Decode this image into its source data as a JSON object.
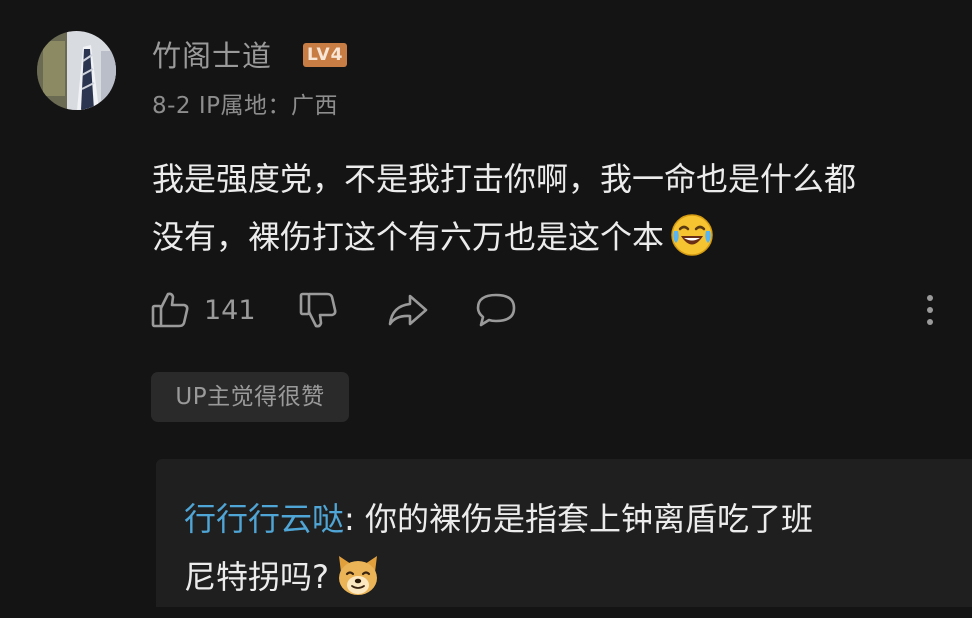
{
  "comment": {
    "username": "竹阁士道",
    "level_badge": "LV4",
    "meta": "8-2 IP属地：广西",
    "content_line1": "我是强度党，不是我打击你啊，我一命也是什么都",
    "content_line2": "没有，裸伤打这个有六万也是这个本",
    "content_emoji": "laugh-cry-emoji",
    "like_count": "141",
    "up_tag": "UP主觉得很赞"
  },
  "reply": {
    "username": "行行行云哒",
    "separator": ": ",
    "text_line1": "你的裸伤是指套上钟离盾吃了班",
    "text_line2": "尼特拐吗?",
    "emoji": "doge-emoji"
  },
  "icons": {
    "like": "thumb-up-icon",
    "dislike": "thumb-down-icon",
    "share": "share-icon",
    "reply": "comment-icon",
    "more": "more-vertical-icon"
  },
  "colors": {
    "background": "#141414",
    "level_badge": "#c87d45",
    "reply_username": "#4fa6d6",
    "reply_box": "#1f1f1f"
  }
}
